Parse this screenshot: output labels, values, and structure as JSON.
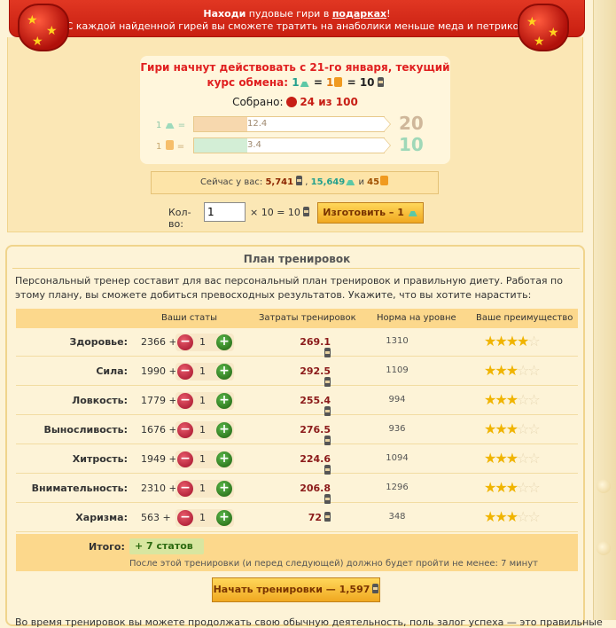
{
  "banner": {
    "line1_bold": "Находи",
    "line1_mid": " пудовые гири в ",
    "line1_link": "подарках",
    "line1_end": "!",
    "line2": "С каждой найденной гирей вы сможете тратить на анаболики меньше меда и петриков."
  },
  "exchange": {
    "title_line1": "Гири начнут действовать с 21-го января, текущий",
    "title_line2_prefix": "курс обмена:",
    "rate_a": "1",
    "rate_b": "1",
    "rate_c": "10",
    "collected_label": "Собрано:",
    "collected_value": "24 из 100",
    "rows": [
      {
        "label": "1",
        "bar_value": "12.4",
        "fill": 0.28,
        "fill_color": "#f7d8ae",
        "big": "20",
        "big_color": "#cfb79a"
      },
      {
        "label": "1",
        "bar_value": "3.4",
        "fill": 0.28,
        "fill_color": "#d3eed6",
        "big": "10",
        "big_color": "#9fd8b8"
      }
    ],
    "have_label": "Сейчас у вас:",
    "have_a": "5,741",
    "have_sep": ",",
    "have_b": "15,649",
    "have_and": "и",
    "have_c": "45",
    "qty_label": "Кол-во:",
    "qty_value": "1",
    "qty_formula": "× 10 = 10",
    "make_button": "Изготовить – 1"
  },
  "plan": {
    "title": "План тренировок",
    "description": "Персональный тренер составит для вас персональный план тренировок и правильную диету. Работая по этому плану, вы сможете добиться превосходных результатов. Укажите, что вы хотите нарастить:",
    "headers": {
      "stats": "Ваши статы",
      "cost": "Затраты тренировок",
      "norm": "Норма на уровне",
      "adv": "Ваше преимущество"
    },
    "rows": [
      {
        "name": "Здоровье:",
        "value": "2366 +",
        "count": "1",
        "cost": "269.1",
        "norm": "1310",
        "stars": 4
      },
      {
        "name": "Сила:",
        "value": "1990 +",
        "count": "1",
        "cost": "292.5",
        "norm": "1109",
        "stars": 3
      },
      {
        "name": "Ловкость:",
        "value": "1779 +",
        "count": "1",
        "cost": "255.4",
        "norm": "994",
        "stars": 3
      },
      {
        "name": "Выносливость:",
        "value": "1676 +",
        "count": "1",
        "cost": "276.5",
        "norm": "936",
        "stars": 3
      },
      {
        "name": "Хитрость:",
        "value": "1949 +",
        "count": "1",
        "cost": "224.6",
        "norm": "1094",
        "stars": 3
      },
      {
        "name": "Внимательность:",
        "value": "2310 +",
        "count": "1",
        "cost": "206.8",
        "norm": "1296",
        "stars": 3
      },
      {
        "name": "Харизма:",
        "value": "563 +",
        "count": "1",
        "cost": "72",
        "norm": "348",
        "stars": 3
      }
    ],
    "total_label": "Итого:",
    "total_value": "+    7 статов",
    "note": "После этой тренировки (и перед следующей) должно будет пройти не менее: 7 минут",
    "start_button": "Начать тренировки — 1,597",
    "footer": "Во время тренировок вы можете продолжать свою обычную деятельность, поль залог успеха — это правильные"
  },
  "colors": {
    "banner": "#d42a18",
    "accent_button": "#f0a820",
    "panel": "#fbe7b5"
  }
}
